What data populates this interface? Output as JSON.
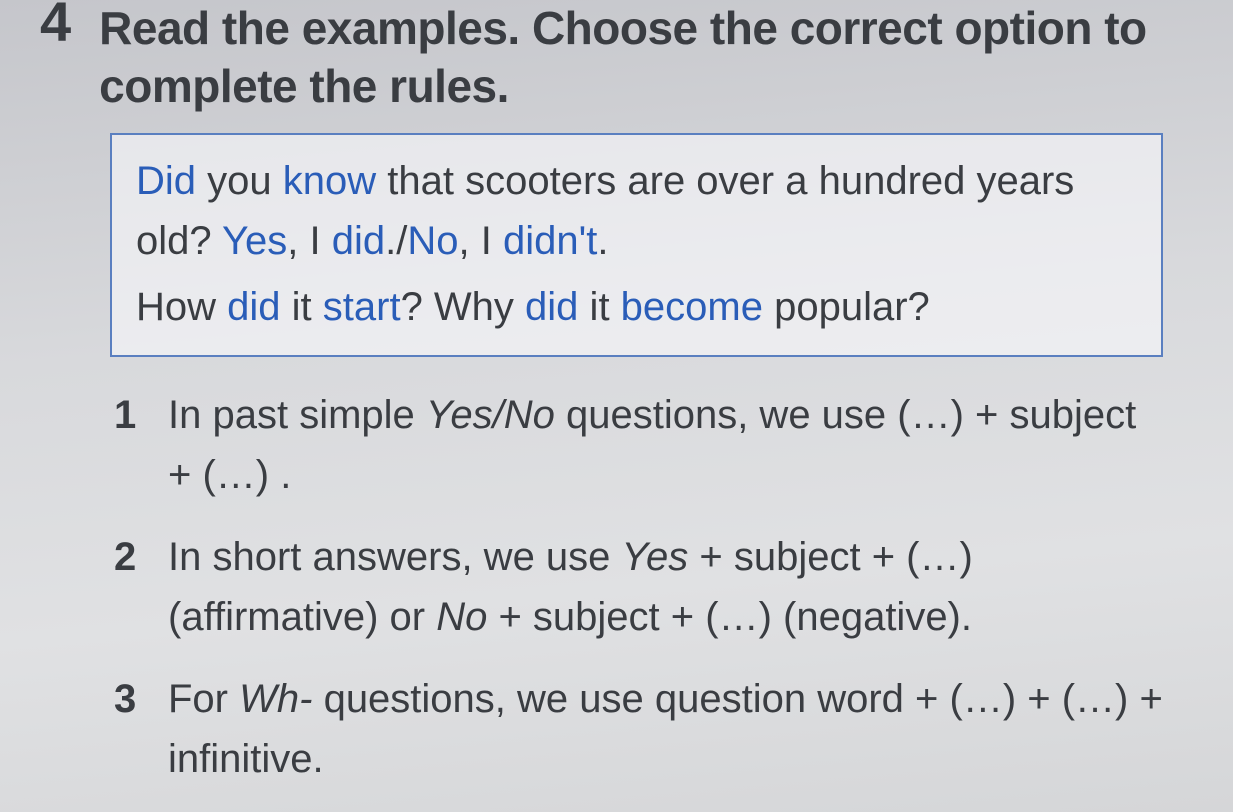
{
  "task": {
    "number": "4",
    "instruction": "Read the examples. Choose the correct option to complete the rules."
  },
  "examples": {
    "line1": {
      "p1": "Did",
      "p2": " you ",
      "p3": "know",
      "p4": " that scooters are over a hundred years old? ",
      "p5": "Yes",
      "p6": ", I ",
      "p7": "did",
      "p8": "./",
      "p9": "No",
      "p10": ", I ",
      "p11": "didn't",
      "p12": "."
    },
    "line2": {
      "p1": "How ",
      "p2": "did",
      "p3": " it ",
      "p4": "start",
      "p5": "?  Why ",
      "p6": "did",
      "p7": " it ",
      "p8": "become",
      "p9": " popular?"
    }
  },
  "rules": [
    {
      "num": "1",
      "segments": {
        "a": "In past simple ",
        "b": "Yes/No",
        "c": " questions, we use (…) + subject + (…) ."
      }
    },
    {
      "num": "2",
      "segments": {
        "a": "In short answers, we use ",
        "b": "Yes",
        "c": " + subject + (…) (affirmative) or ",
        "d": "No",
        "e": " + subject + (…) (negative)."
      }
    },
    {
      "num": "3",
      "segments": {
        "a": "For ",
        "b": "Wh-",
        "c": " questions, we use question word + (…) + (…) + infinitive."
      }
    }
  ]
}
